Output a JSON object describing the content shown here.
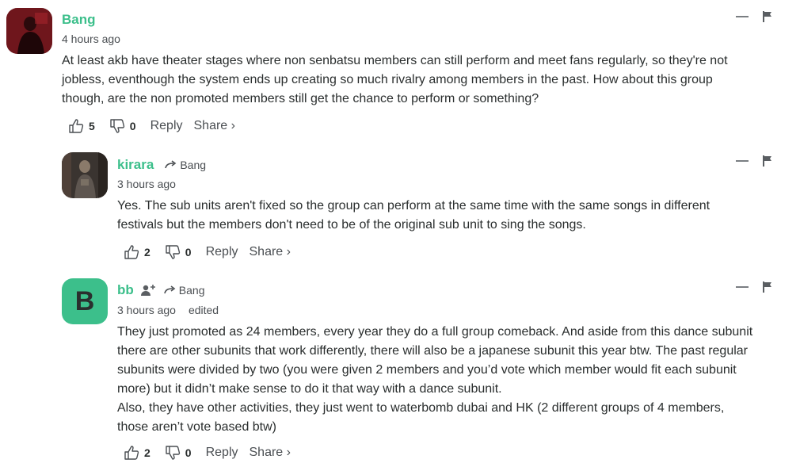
{
  "comments": [
    {
      "author": "Bang",
      "time": "4 hours ago",
      "lines": [
        "At least akb have theater stages where non senbatsu members can still perform and meet fans regularly, so they're not",
        "jobless, eventhough the system ends up creating so much rivalry among members in the past. How about this group",
        "though, are the non promoted members still get the chance to perform or something?"
      ],
      "likes": "5",
      "dislikes": "0",
      "reply_label": "Reply",
      "share_label": "Share ›",
      "avatar_icon": "photo-avatar"
    },
    {
      "author": "kirara",
      "reply_to": "Bang",
      "time": "3 hours ago",
      "lines": [
        "Yes. The sub units aren't fixed so the group can perform at the same time with the same songs in different",
        "festivals but the members don't need to be of the original sub unit to sing the songs."
      ],
      "likes": "2",
      "dislikes": "0",
      "reply_label": "Reply",
      "share_label": "Share ›",
      "avatar_icon": "photo-avatar"
    },
    {
      "author": "bb",
      "reply_to": "Bang",
      "time": "3 hours ago",
      "edited": "edited",
      "avatar_letter": "B",
      "avatar_color": "#3cbf8b",
      "lines": [
        "They just promoted as 24 members, every year they do a full group comeback. And aside from this dance subunit",
        "there are other subunits that work differently, there will also be a japanese subunit this year btw. The past regular",
        "subunits were divided by two (you were given 2 members and you’d vote which member would fit each subunit",
        "more) but it didn’t make sense to do it that way with a dance subunit.",
        "Also, they have other activities, they just went to waterbomb dubai and HK (2 different groups of 4 members,",
        "those aren’t vote based btw)"
      ],
      "likes": "2",
      "dislikes": "0",
      "reply_label": "Reply",
      "share_label": "Share ›"
    }
  ],
  "colors": {
    "accent": "#3cbf8b",
    "text": "#2a2e2e",
    "muted": "#4a4e52"
  }
}
